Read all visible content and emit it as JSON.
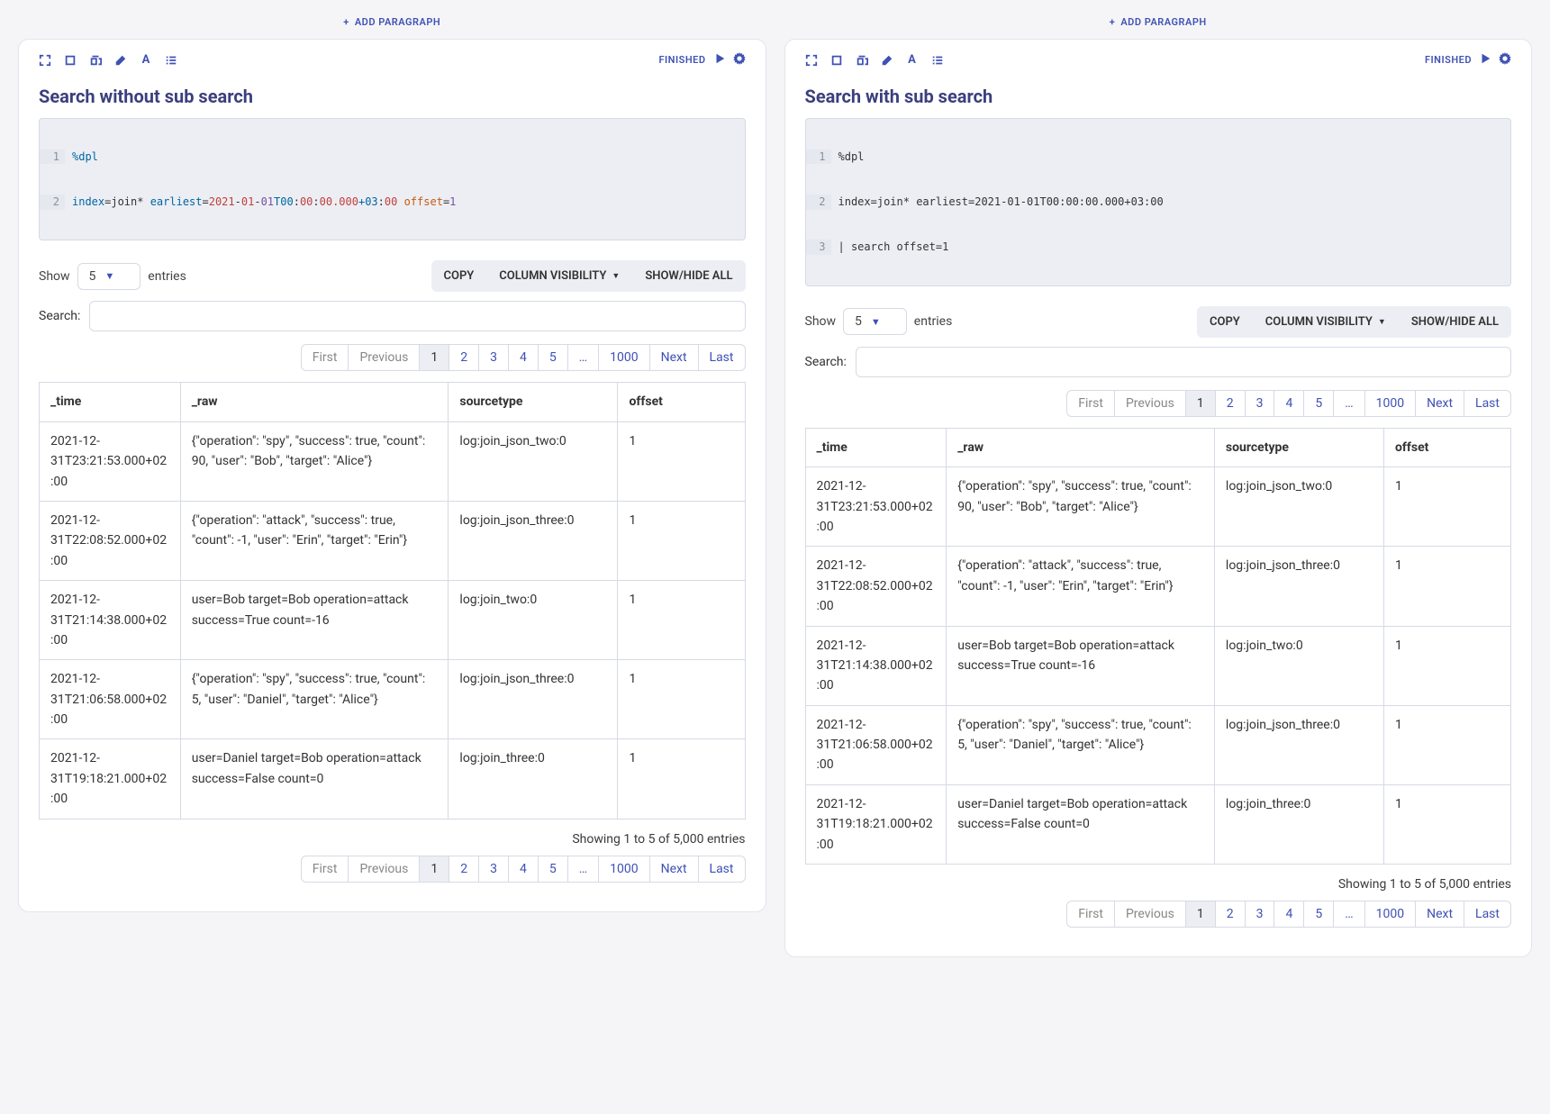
{
  "addParagraphLabel": "ADD PARAGRAPH",
  "finishedLabel": "FINISHED",
  "controls": {
    "showLabel": "Show",
    "entriesLabel": "entries",
    "pageSize": "5",
    "copyLabel": "COPY",
    "colVisLabel": "COLUMN VISIBILITY",
    "showHideLabel": "SHOW/HIDE ALL",
    "searchLabel": "Search:"
  },
  "pagination": {
    "first": "First",
    "previous": "Previous",
    "pages": [
      "1",
      "2",
      "3",
      "4",
      "5",
      "…",
      "1000"
    ],
    "next": "Next",
    "last": "Last",
    "active": "1"
  },
  "table": {
    "columns": [
      "_time",
      "_raw",
      "sourcetype",
      "offset"
    ],
    "rows": [
      {
        "time": "2021-12-31T23:21:53.000+02:00",
        "raw": "{\"operation\": \"spy\", \"success\": true, \"count\": 90, \"user\": \"Bob\", \"target\": \"Alice\"}",
        "sourcetype": "log:join_json_two:0",
        "offset": "1"
      },
      {
        "time": "2021-12-31T22:08:52.000+02:00",
        "raw": "{\"operation\": \"attack\", \"success\": true, \"count\": -1, \"user\": \"Erin\", \"target\": \"Erin\"}",
        "sourcetype": "log:join_json_three:0",
        "offset": "1"
      },
      {
        "time": "2021-12-31T21:14:38.000+02:00",
        "raw": "user=Bob target=Bob operation=attack success=True count=-16",
        "sourcetype": "log:join_two:0",
        "offset": "1"
      },
      {
        "time": "2021-12-31T21:06:58.000+02:00",
        "raw": "{\"operation\": \"spy\", \"success\": true, \"count\": 5, \"user\": \"Daniel\", \"target\": \"Alice\"}",
        "sourcetype": "log:join_json_three:0",
        "offset": "1"
      },
      {
        "time": "2021-12-31T19:18:21.000+02:00",
        "raw": "user=Daniel target=Bob operation=attack success=False count=0",
        "sourcetype": "log:join_three:0",
        "offset": "1"
      }
    ],
    "info": "Showing 1 to 5 of 5,000 entries"
  },
  "left": {
    "title": "Search without sub search",
    "code": {
      "lines": [
        "1",
        "2"
      ],
      "line1": {
        "a": "%dpl"
      },
      "line2": {
        "a": "index",
        "b": "=join* ",
        "c": "earliest",
        "d": "=",
        "e": "2021",
        "f": "-",
        "g": "01",
        "h": "-",
        "i": "01",
        "j": "T00",
        "k": ":",
        "l": "00",
        "m": ":",
        "n": "00.000",
        "o": "+03",
        "p": ":",
        "q": "00",
        "r": " offset",
        "s": "=",
        "t": "1"
      }
    }
  },
  "right": {
    "title": "Search with sub search",
    "code": {
      "lines": [
        "1",
        "2",
        "3"
      ],
      "line1": "%dpl",
      "line2": "index=join* earliest=2021-01-01T00:00:00.000+03:00",
      "line3": "| search offset=1"
    }
  }
}
